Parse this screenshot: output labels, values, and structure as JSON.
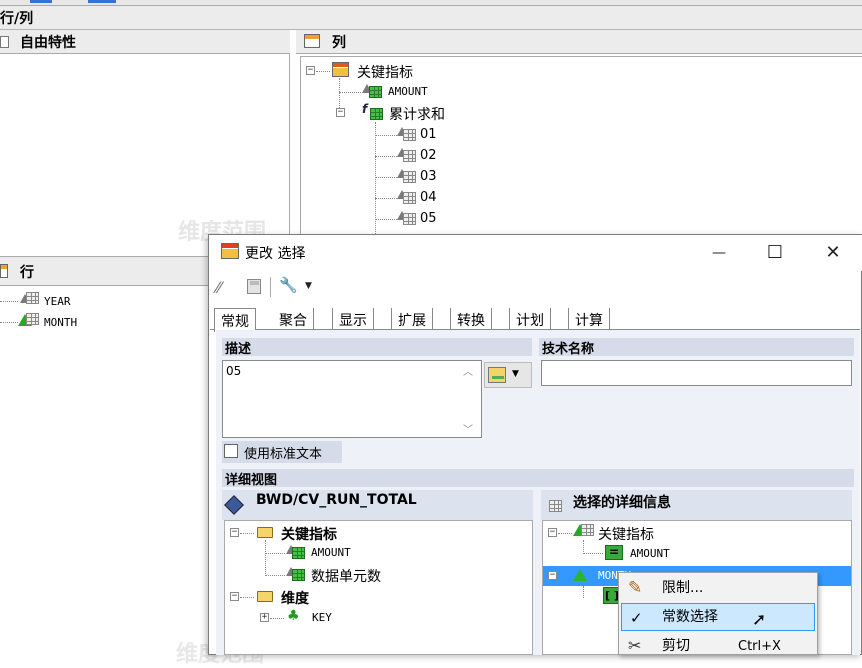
{
  "background": {
    "section_title": "行/列",
    "free_chars_title": "自由特性",
    "columns_title": "列",
    "rows_title": "行",
    "watermark": "维度范围",
    "columns_tree": {
      "root": "关键指标",
      "amount": "AMOUNT",
      "cumulative": "累计求和",
      "children": [
        "01",
        "02",
        "03",
        "04",
        "05"
      ]
    },
    "rows_tree": [
      "YEAR",
      "MONTH"
    ]
  },
  "dialog": {
    "title": "更改 选择",
    "title_buttons": {
      "minimize": "—",
      "maximize": "☐",
      "close": "✕"
    },
    "tabs": [
      "常规",
      "聚合",
      "显示",
      "扩展",
      "转换",
      "计划",
      "计算"
    ],
    "description_label": "描述",
    "description_value": "05",
    "tech_name_label": "技术名称",
    "tech_name_value": "",
    "use_standard_text": "使用标准文本",
    "detail_view_label": "详细视图",
    "left_tree": {
      "header": "BWD/CV_RUN_TOTAL",
      "key_figures": "关键指标",
      "amount": "AMOUNT",
      "cell_count": "数据单元数",
      "dimension": "维度",
      "key": "KEY"
    },
    "right_tree": {
      "header": "选择的详细信息",
      "key_figures": "关键指标",
      "amount": "AMOUNT",
      "month": "MONTH"
    }
  },
  "context_menu": {
    "items": [
      {
        "label": "限制...",
        "shortcut": ""
      },
      {
        "label": "常数选择",
        "shortcut": ""
      },
      {
        "label": "剪切",
        "shortcut": "Ctrl+X"
      }
    ]
  },
  "colors": {
    "header_bg": "#d6dbe9",
    "selection": "#3399ff",
    "menu_highlight": "#cce8ff"
  }
}
